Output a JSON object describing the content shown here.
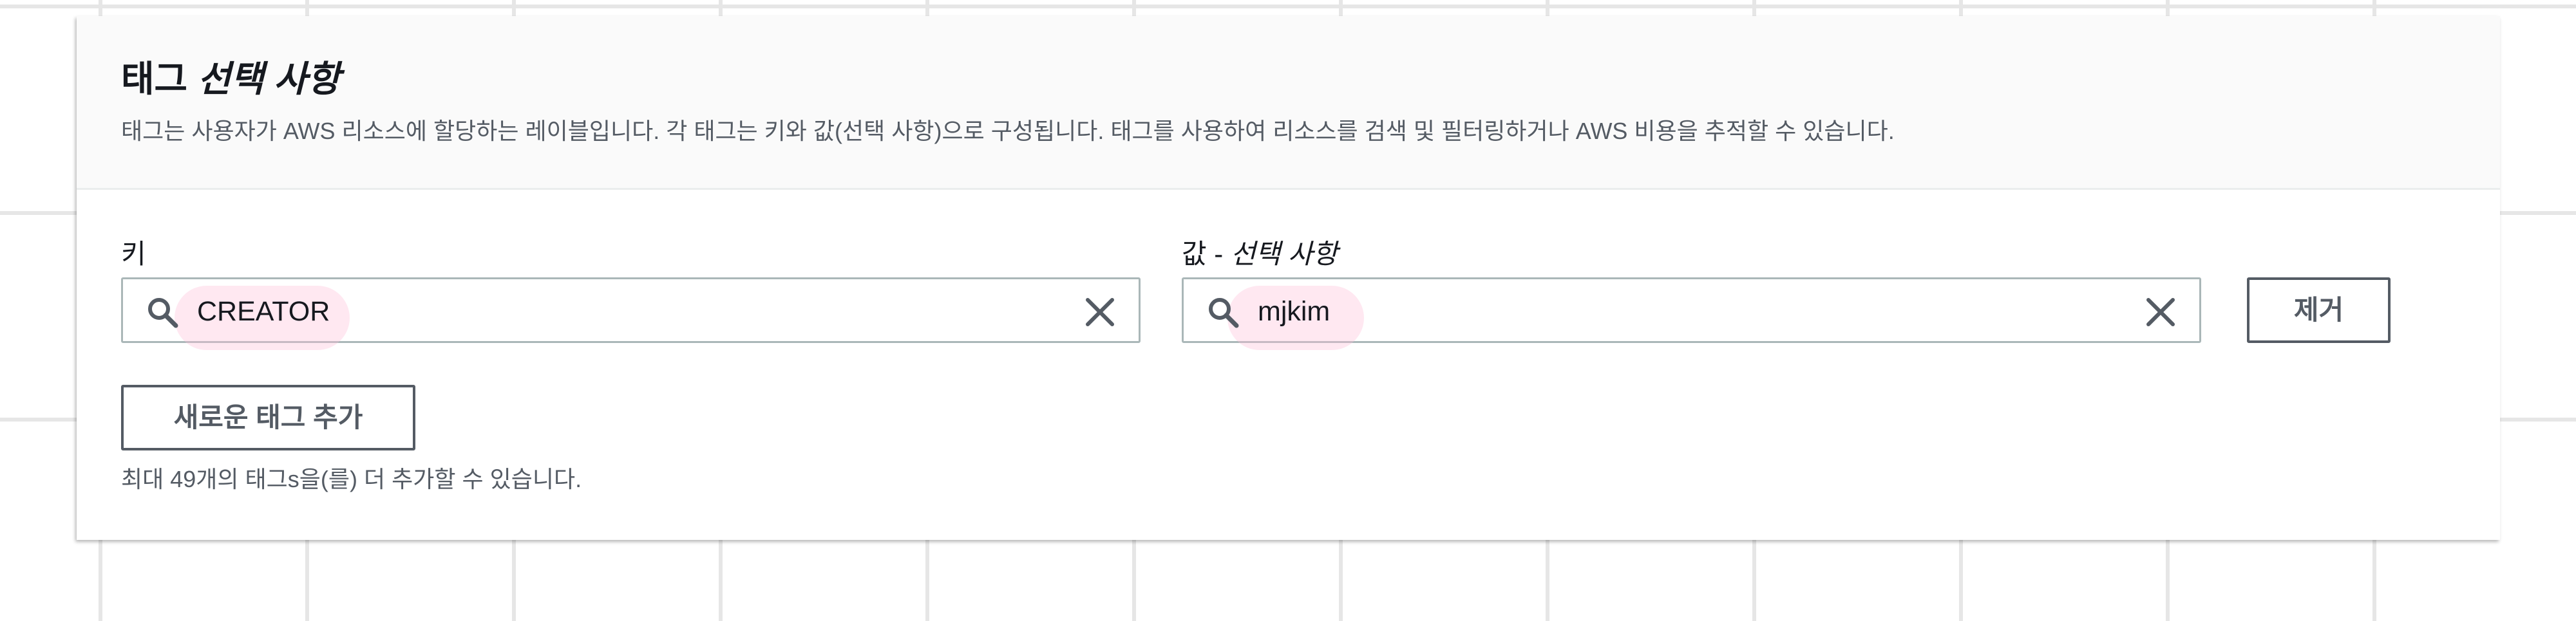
{
  "panel": {
    "title_main": "태그 ",
    "title_optional": "선택 사항",
    "description": "태그는 사용자가 AWS 리소스에 할당하는 레이블입니다. 각 태그는 키와 값(선택 사항)으로 구성됩니다. 태그를 사용하여 리소스를 검색 및 필터링하거나 AWS 비용을 추적할 수 있습니다."
  },
  "tag_row": {
    "key_label": "키",
    "key_value": "CREATOR",
    "value_label_main": "값 - ",
    "value_label_optional": "선택 사항",
    "value_value": "mjkim",
    "remove_label": "제거"
  },
  "add_tag": {
    "button_label": "새로운 태그 추가",
    "limit_note": "최대 49개의 태그s을(를) 더 추가할 수 있습니다."
  },
  "icons": {
    "search": "search-icon",
    "clear": "close-icon"
  },
  "colors": {
    "text_primary": "#16191f",
    "text_secondary": "#545b64",
    "input_border": "#aab7b8",
    "header_bg": "#fafafa"
  }
}
